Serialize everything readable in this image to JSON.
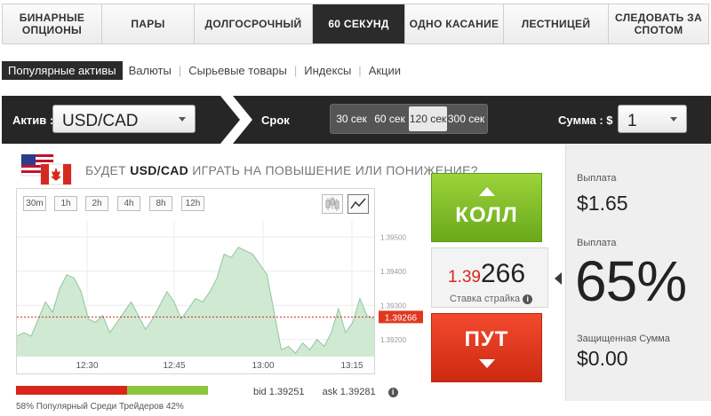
{
  "top_tabs": [
    {
      "label": "БИНАРНЫЕ ОПЦИОНЫ",
      "active": false
    },
    {
      "label": "ПАРЫ",
      "active": false
    },
    {
      "label": "ДОЛГОСРОЧНЫЙ",
      "active": false
    },
    {
      "label": "60 СЕКУНД",
      "active": true
    },
    {
      "label": "ОДНО КАСАНИЕ",
      "active": false
    },
    {
      "label": "ЛЕСТНИЦЕЙ",
      "active": false
    },
    {
      "label": "СЛЕДОВАТЬ ЗА СПОТОМ",
      "active": false
    }
  ],
  "categories": [
    {
      "label": "Популярные активы",
      "active": true
    },
    {
      "label": "Валюты",
      "active": false
    },
    {
      "label": "Сырьевые товары",
      "active": false
    },
    {
      "label": "Индексы",
      "active": false
    },
    {
      "label": "Акции",
      "active": false
    }
  ],
  "controls": {
    "asset_label": "Актив :",
    "asset_value": "USD/CAD",
    "term_label": "Срок",
    "terms": [
      {
        "label": "30 сек",
        "active": false
      },
      {
        "label": "60 сек",
        "active": false
      },
      {
        "label": "120 сек",
        "active": true
      },
      {
        "label": "300 сек",
        "active": false
      }
    ],
    "amount_label": "Сумма : $",
    "amount_value": "1"
  },
  "question": {
    "prefix": "БУДЕТ ",
    "asset": "USD/CAD",
    "suffix": " ИГРАТЬ НА ПОВЫШЕНИЕ ИЛИ ПОНИЖЕНИЕ?"
  },
  "timeframes": [
    "30m",
    "1h",
    "2h",
    "4h",
    "8h",
    "12h"
  ],
  "chart_data": {
    "type": "area",
    "x_ticks": [
      "12:30",
      "12:45",
      "13:00",
      "13:15"
    ],
    "y_ticks": [
      "1.39500",
      "1.39400",
      "1.39300",
      "1.39200"
    ],
    "ylim": [
      1.3915,
      1.3955
    ],
    "current_label": "1.39266",
    "series": [
      {
        "values": [
          1.3921,
          1.3922,
          1.3921,
          1.3926,
          1.3931,
          1.3928,
          1.3935,
          1.3939,
          1.3938,
          1.3934,
          1.3926,
          1.3925,
          1.3927,
          1.3922,
          1.3925,
          1.3928,
          1.3931,
          1.3927,
          1.3923,
          1.3926,
          1.393,
          1.3934,
          1.3931,
          1.3926,
          1.3929,
          1.3932,
          1.3931,
          1.3934,
          1.3938,
          1.3945,
          1.3944,
          1.3947,
          1.3946,
          1.3945,
          1.3942,
          1.3939,
          1.3928,
          1.3917,
          1.3918,
          1.3916,
          1.3919,
          1.3917,
          1.392,
          1.3918,
          1.3922,
          1.3929,
          1.3922,
          1.3925,
          1.3932,
          1.3927,
          1.3926
        ]
      }
    ]
  },
  "call": {
    "label": "КОЛЛ"
  },
  "put": {
    "label": "ПУТ"
  },
  "strike": {
    "prefix": "1.39",
    "main": "266",
    "label": "Ставка страйка"
  },
  "payout": {
    "label1": "Выплата",
    "value1": "$1.65",
    "label2": "Выплата",
    "value2": "65%",
    "label3": "Защищенная Сумма",
    "value3": "$0.00"
  },
  "sentiment": {
    "put_pct": 58,
    "call_pct": 42,
    "text": "58%  Популярный Среди Трейдеров  42%",
    "put_color": "#d7261b",
    "call_color": "#8cc63f"
  },
  "quote": {
    "bid": "bid 1.39251",
    "ask": "ask 1.39281"
  },
  "colors": {
    "call": "#7cbf24",
    "put": "#e0381f",
    "active_tab": "#2b2b2b"
  }
}
